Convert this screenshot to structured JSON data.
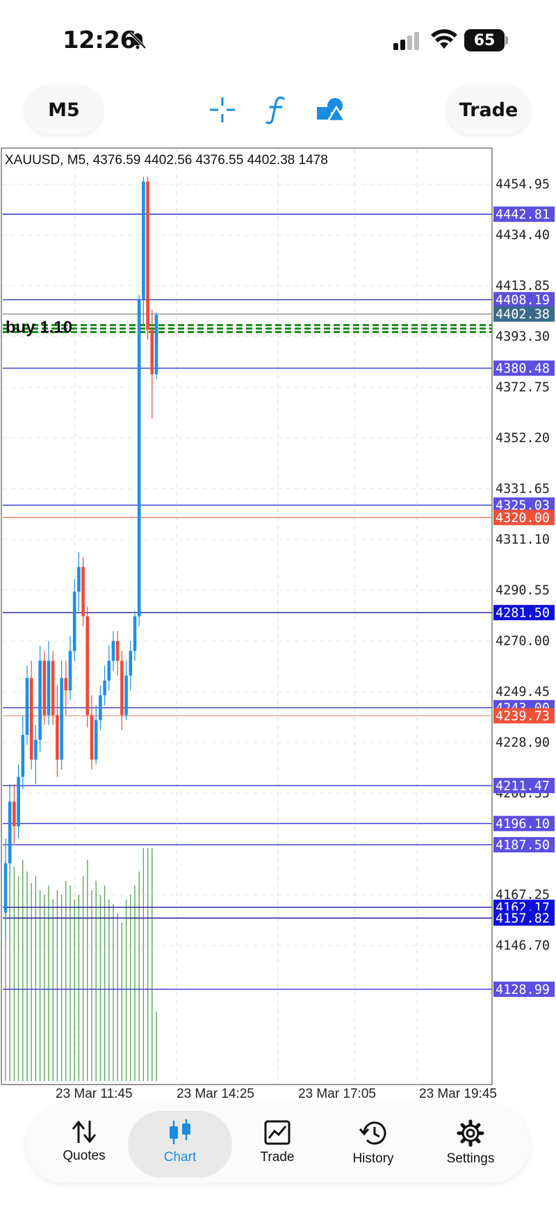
{
  "status_bar": {
    "time": "12:26",
    "battery": "65"
  },
  "toolbar": {
    "timeframe": "M5",
    "trade_label": "Trade",
    "icons": [
      "crosshair-icon",
      "indicator-f-icon",
      "objects-shapes-icon"
    ]
  },
  "chart_data": {
    "type": "candlestick",
    "symbol": "XAUUSD",
    "timeframe": "M5",
    "header": "XAUUSD, M5, 4376.59 4402.56 4376.55 4402.38 1478",
    "open": 4376.59,
    "high": 4402.56,
    "low": 4376.55,
    "close": 4402.38,
    "volume": 1478,
    "price_ticks": [
      "4454.95",
      "4434.40",
      "4413.85",
      "4393.30",
      "4372.75",
      "4352.20",
      "4331.65",
      "4311.10",
      "4290.55",
      "4270.00",
      "4249.45",
      "4228.90",
      "4208.35",
      "4167.25",
      "4146.70"
    ],
    "x_labels": [
      "23 Mar 11:45",
      "23 Mar 14:25",
      "23 Mar 17:05",
      "23 Mar 19:45"
    ],
    "ylim": [
      4126,
      4460
    ],
    "grid": true,
    "horizontal_lines": [
      {
        "price": 4442.81,
        "label": "4442.81",
        "color": "#3333cc",
        "tag_color": "#5a4fe0"
      },
      {
        "price": 4408.19,
        "label": "4408.19",
        "color": "#3333cc",
        "tag_color": "#5a4fe0"
      },
      {
        "price": 4402.38,
        "label": "4402.38",
        "color": "#999999",
        "tag_color": "#3a6b8a"
      },
      {
        "price": 4380.48,
        "label": "4380.48",
        "color": "#3333cc",
        "tag_color": "#5a4fe0"
      },
      {
        "price": 4325.03,
        "label": "4325.03",
        "color": "#3333cc",
        "tag_color": "#5a4fe0"
      },
      {
        "price": 4320.0,
        "label": "4320.00",
        "color": "#f08070",
        "tag_color": "#f0503a"
      },
      {
        "price": 4281.5,
        "label": "4281.50",
        "color": "#1a1a9a",
        "tag_color": "#1010d8"
      },
      {
        "price": 4243.0,
        "label": "4243.00",
        "color": "#3333cc",
        "tag_color": "#5a4fe0"
      },
      {
        "price": 4239.73,
        "label": "4239.73",
        "color": "#f0a090",
        "tag_color": "#f0503a"
      },
      {
        "price": 4211.47,
        "label": "4211.47",
        "color": "#3333cc",
        "tag_color": "#5a4fe0"
      },
      {
        "price": 4196.1,
        "label": "4196.10",
        "color": "#3333cc",
        "tag_color": "#5a4fe0"
      },
      {
        "price": 4187.5,
        "label": "4187.50",
        "color": "#3333cc",
        "tag_color": "#5a4fe0"
      },
      {
        "price": 4162.17,
        "label": "4162.17",
        "color": "#1a1a9a",
        "tag_color": "#1010d8"
      },
      {
        "price": 4157.82,
        "label": "4157.82",
        "color": "#1a1a9a",
        "tag_color": "#1010d8"
      },
      {
        "price": 4128.99,
        "label": "4128.99",
        "color": "#3333cc",
        "tag_color": "#5a4fe0"
      }
    ],
    "position_line": {
      "price": 4396.5,
      "label": "buy 1.10",
      "color": "#1a8a1a"
    },
    "candles": [
      {
        "o": 4160,
        "h": 4190,
        "l": 4150,
        "c": 4180
      },
      {
        "o": 4180,
        "h": 4212,
        "l": 4175,
        "c": 4205
      },
      {
        "o": 4205,
        "h": 4212,
        "l": 4188,
        "c": 4195
      },
      {
        "o": 4195,
        "h": 4220,
        "l": 4190,
        "c": 4215
      },
      {
        "o": 4215,
        "h": 4240,
        "l": 4210,
        "c": 4232
      },
      {
        "o": 4232,
        "h": 4260,
        "l": 4228,
        "c": 4255
      },
      {
        "o": 4255,
        "h": 4262,
        "l": 4218,
        "c": 4222
      },
      {
        "o": 4222,
        "h": 4236,
        "l": 4212,
        "c": 4230
      },
      {
        "o": 4230,
        "h": 4268,
        "l": 4225,
        "c": 4262
      },
      {
        "o": 4262,
        "h": 4266,
        "l": 4236,
        "c": 4240
      },
      {
        "o": 4240,
        "h": 4270,
        "l": 4236,
        "c": 4262
      },
      {
        "o": 4262,
        "h": 4266,
        "l": 4236,
        "c": 4240
      },
      {
        "o": 4240,
        "h": 4252,
        "l": 4215,
        "c": 4222
      },
      {
        "o": 4222,
        "h": 4262,
        "l": 4218,
        "c": 4255
      },
      {
        "o": 4255,
        "h": 4262,
        "l": 4240,
        "c": 4250
      },
      {
        "o": 4250,
        "h": 4272,
        "l": 4246,
        "c": 4266
      },
      {
        "o": 4266,
        "h": 4295,
        "l": 4262,
        "c": 4290
      },
      {
        "o": 4290,
        "h": 4306,
        "l": 4282,
        "c": 4300
      },
      {
        "o": 4300,
        "h": 4304,
        "l": 4276,
        "c": 4280
      },
      {
        "o": 4280,
        "h": 4284,
        "l": 4235,
        "c": 4240
      },
      {
        "o": 4240,
        "h": 4248,
        "l": 4218,
        "c": 4222
      },
      {
        "o": 4222,
        "h": 4244,
        "l": 4220,
        "c": 4238
      },
      {
        "o": 4238,
        "h": 4252,
        "l": 4234,
        "c": 4248
      },
      {
        "o": 4248,
        "h": 4260,
        "l": 4244,
        "c": 4254
      },
      {
        "o": 4254,
        "h": 4268,
        "l": 4250,
        "c": 4262
      },
      {
        "o": 4262,
        "h": 4274,
        "l": 4258,
        "c": 4270
      },
      {
        "o": 4270,
        "h": 4274,
        "l": 4256,
        "c": 4262
      },
      {
        "o": 4262,
        "h": 4266,
        "l": 4234,
        "c": 4240
      },
      {
        "o": 4240,
        "h": 4262,
        "l": 4238,
        "c": 4256
      },
      {
        "o": 4256,
        "h": 4270,
        "l": 4250,
        "c": 4266
      },
      {
        "o": 4266,
        "h": 4282,
        "l": 4262,
        "c": 4280
      },
      {
        "o": 4280,
        "h": 4410,
        "l": 4276,
        "c": 4408
      },
      {
        "o": 4408,
        "h": 4458,
        "l": 4398,
        "c": 4456
      },
      {
        "o": 4456,
        "h": 4458,
        "l": 4392,
        "c": 4396
      },
      {
        "o": 4396,
        "h": 4404,
        "l": 4360,
        "c": 4378
      },
      {
        "o": 4378,
        "h": 4403,
        "l": 4376,
        "c": 4402
      }
    ],
    "volumes": [
      0.95,
      0.9,
      0.92,
      0.88,
      0.95,
      0.9,
      0.85,
      0.88,
      0.82,
      0.8,
      0.84,
      0.78,
      0.82,
      0.8,
      0.86,
      0.84,
      0.78,
      0.8,
      0.88,
      0.95,
      0.82,
      0.86,
      0.8,
      0.84,
      0.78,
      0.76,
      0.72,
      0.68,
      0.78,
      0.8,
      0.84,
      0.9,
      1.0,
      1.0,
      1.0,
      0.3
    ]
  },
  "bottom_nav": {
    "items": [
      {
        "label": "Quotes",
        "icon": "quotes-arrows-icon"
      },
      {
        "label": "Chart",
        "icon": "candlestick-chart-icon"
      },
      {
        "label": "Trade",
        "icon": "trade-chart-icon"
      },
      {
        "label": "History",
        "icon": "history-clock-icon"
      },
      {
        "label": "Settings",
        "icon": "settings-gear-icon"
      }
    ],
    "active": "Chart"
  },
  "colors": {
    "bull": "#1f8fe5",
    "bear": "#ee4a3a",
    "accent": "#1a8de0",
    "volume": "#5aa85a"
  }
}
